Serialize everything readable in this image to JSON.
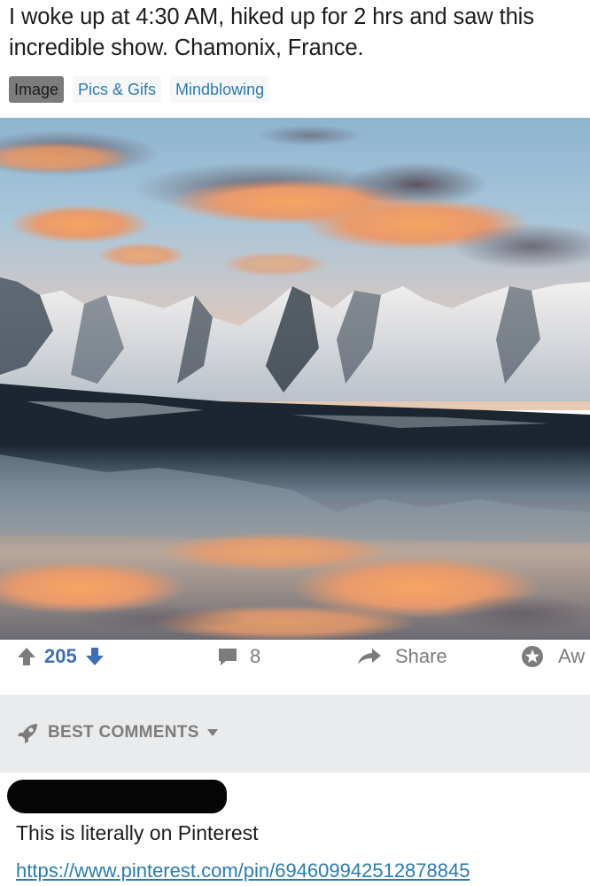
{
  "post": {
    "title": "I woke up at 4:30 AM, hiked up for 2 hrs and saw this incredible show. Chamonix, France.",
    "flairs": [
      "Image",
      "Pics & Gifs",
      "Mindblowing"
    ]
  },
  "actions": {
    "vote_count": "205",
    "comment_count": "8",
    "share_label": "Share",
    "award_label": "Aw"
  },
  "comments_section": {
    "sort_label": "BEST COMMENTS"
  },
  "comment": {
    "text": "This is literally on Pinterest",
    "link": "https://www.pinterest.com/pin/694609942512878845"
  },
  "colors": {
    "link": "#2a7bb0",
    "vote_accent": "#3d6fb6",
    "muted": "#7c7c7c"
  }
}
